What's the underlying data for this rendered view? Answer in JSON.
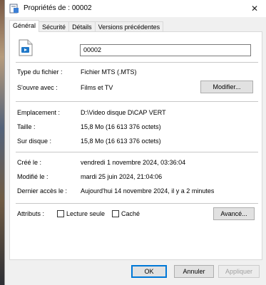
{
  "window": {
    "title": "Propriétés de : 00002",
    "close_glyph": "✕"
  },
  "tabs": [
    {
      "label": "Général",
      "active": true
    },
    {
      "label": "Sécurité",
      "active": false
    },
    {
      "label": "Détails",
      "active": false
    },
    {
      "label": "Versions précédentes",
      "active": false
    }
  ],
  "general": {
    "filename": "00002",
    "file_type_label": "Type du fichier :",
    "file_type_value": "Fichier MTS (.MTS)",
    "opens_with_label": "S'ouvre avec :",
    "opens_with_value": "Films et TV",
    "change_button": "Modifier...",
    "location_label": "Emplacement :",
    "location_value": "D:\\Video disque D\\CAP VERT",
    "size_label": "Taille :",
    "size_value": "15,8 Mo (16 613 376 octets)",
    "size_on_disk_label": "Sur disque :",
    "size_on_disk_value": "15,8 Mo (16 613 376 octets)",
    "created_label": "Créé le :",
    "created_value": "vendredi 1 novembre 2024, 03:36:04",
    "modified_label": "Modifié le :",
    "modified_value": "mardi 25 juin 2024, 21:04:06",
    "accessed_label": "Dernier accès le :",
    "accessed_value": "Aujourd'hui 14 novembre 2024, il y a 2 minutes",
    "attributes_label": "Attributs :",
    "readonly_label": "Lecture seule",
    "readonly_checked": false,
    "hidden_label": "Caché",
    "hidden_checked": false,
    "advanced_button": "Avancé..."
  },
  "footer": {
    "ok": "OK",
    "cancel": "Annuler",
    "apply": "Appliquer"
  },
  "colors": {
    "accent": "#0078d7",
    "window_bg": "#f0f0f0",
    "panel_bg": "#ffffff"
  },
  "icons": {
    "title_icon": "document-properties-icon",
    "file_icon": "video-file-icon"
  }
}
